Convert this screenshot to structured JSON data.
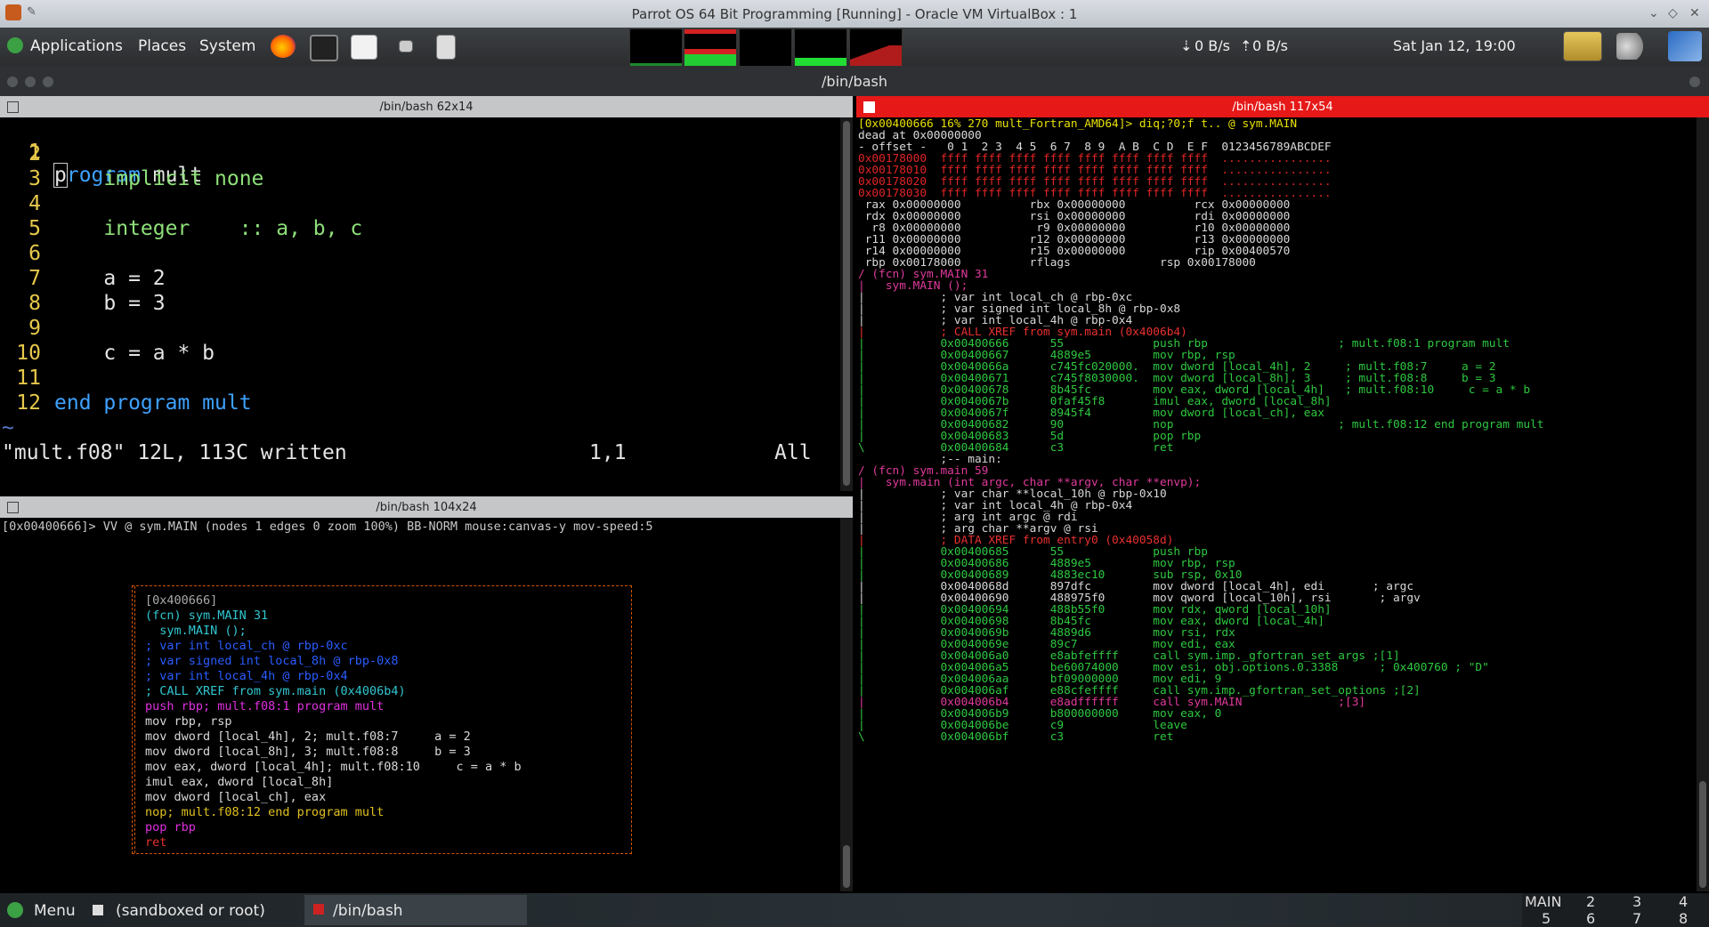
{
  "vbox": {
    "title": "Parrot OS 64 Bit Programming [Running] - Oracle VM VirtualBox : 1"
  },
  "panel": {
    "menu": [
      "Applications",
      "Places",
      "System"
    ],
    "net_down": "0 B/s",
    "net_up": "0 B/s",
    "clock": "Sat Jan 12, 19:00"
  },
  "terminator": {
    "title": "/bin/bash"
  },
  "panes": {
    "vim_title": "/bin/bash 62x14",
    "vv_title": "/bin/bash 104x24",
    "r2_title": "/bin/bash 117x54"
  },
  "vim": {
    "lines": [
      {
        "n": "1",
        "t": "program mult"
      },
      {
        "n": "2",
        "t": ""
      },
      {
        "n": "3",
        "t": "    implicit none"
      },
      {
        "n": "4",
        "t": ""
      },
      {
        "n": "5",
        "t": "    integer    :: a, b, c"
      },
      {
        "n": "6",
        "t": ""
      },
      {
        "n": "7",
        "t": "    a = 2"
      },
      {
        "n": "8",
        "t": "    b = 3"
      },
      {
        "n": "9",
        "t": ""
      },
      {
        "n": "10",
        "t": "    c = a * b"
      },
      {
        "n": "11",
        "t": ""
      },
      {
        "n": "12",
        "t": "end program mult"
      }
    ],
    "tilde": "~",
    "status_msg": "\"mult.f08\" 12L, 113C written",
    "status_pos": "1,1",
    "status_all": "All"
  },
  "vv": {
    "header": "[0x00400666]> VV @ sym.MAIN (nodes 1 edges 0 zoom 100%) BB-NORM mouse:canvas-y mov-speed:5",
    "box_lines": [
      "[0x400666]",
      "(fcn) sym.MAIN 31",
      "  sym.MAIN ();",
      "; var int local_ch @ rbp-0xc",
      "; var signed int local_8h @ rbp-0x8",
      "; var int local_4h @ rbp-0x4",
      "; CALL XREF from sym.main (0x4006b4)",
      "push rbp; mult.f08:1 program mult",
      "mov rbp, rsp",
      "mov dword [local_4h], 2; mult.f08:7     a = 2",
      "mov dword [local_8h], 3; mult.f08:8     b = 3",
      "mov eax, dword [local_4h]; mult.f08:10     c = a * b",
      "imul eax, dword [local_8h]",
      "mov dword [local_ch], eax",
      "nop; mult.f08:12 end program mult",
      "pop rbp",
      "ret"
    ]
  },
  "r2": {
    "lines": [
      "[0x00400666 16% 270 mult_Fortran_AMD64]> diq;?0;f t.. @ sym.MAIN",
      "dead at 0x00000000",
      "- offset -   0 1  2 3  4 5  6 7  8 9  A B  C D  E F  0123456789ABCDEF",
      "0x00178000  ffff ffff ffff ffff ffff ffff ffff ffff  ................",
      "0x00178010  ffff ffff ffff ffff ffff ffff ffff ffff  ................",
      "0x00178020  ffff ffff ffff ffff ffff ffff ffff ffff  ................",
      "0x00178030  ffff ffff ffff ffff ffff ffff ffff ffff  ................",
      " rax 0x00000000          rbx 0x00000000          rcx 0x00000000",
      " rdx 0x00000000          rsi 0x00000000          rdi 0x00000000",
      "  r8 0x00000000           r9 0x00000000          r10 0x00000000",
      " r11 0x00000000          r12 0x00000000          r13 0x00000000",
      " r14 0x00000000          r15 0x00000000          rip 0x00400570",
      " rbp 0x00178000          rflags             rsp 0x00178000",
      "/ (fcn) sym.MAIN 31",
      "|   sym.MAIN ();",
      "|           ; var int local_ch @ rbp-0xc",
      "|           ; var signed int local_8h @ rbp-0x8",
      "|           ; var int local_4h @ rbp-0x4",
      "|           ; CALL XREF from sym.main (0x4006b4)",
      "|           0x00400666      55             push rbp                   ; mult.f08:1 program mult",
      "|           0x00400667      4889e5         mov rbp, rsp",
      "|           0x0040066a      c745fc020000.  mov dword [local_4h], 2     ; mult.f08:7     a = 2",
      "|           0x00400671      c745f8030000.  mov dword [local_8h], 3     ; mult.f08:8     b = 3",
      "|           0x00400678      8b45fc         mov eax, dword [local_4h]   ; mult.f08:10     c = a * b",
      "|           0x0040067b      0faf45f8       imul eax, dword [local_8h]",
      "|           0x0040067f      8945f4         mov dword [local_ch], eax",
      "|           0x00400682      90             nop                        ; mult.f08:12 end program mult",
      "|           0x00400683      5d             pop rbp",
      "\\           0x00400684      c3             ret",
      "            ;-- main:",
      "/ (fcn) sym.main 59",
      "|   sym.main (int argc, char **argv, char **envp);",
      "|           ; var char **local_10h @ rbp-0x10",
      "|           ; var int local_4h @ rbp-0x4",
      "|           ; arg int argc @ rdi",
      "|           ; arg char **argv @ rsi",
      "|           ; DATA XREF from entry0 (0x40058d)",
      "|           0x00400685      55             push rbp",
      "|           0x00400686      4889e5         mov rbp, rsp",
      "|           0x00400689      4883ec10       sub rsp, 0x10",
      "|           0x0040068d      897dfc         mov dword [local_4h], edi       ; argc",
      "|           0x00400690      488975f0       mov qword [local_10h], rsi       ; argv",
      "|           0x00400694      488b55f0       mov rdx, qword [local_10h]",
      "|           0x00400698      8b45fc         mov eax, dword [local_4h]",
      "|           0x0040069b      4889d6         mov rsi, rdx",
      "|           0x0040069e      89c7           mov edi, eax",
      "|           0x004006a0      e8abfeffff     call sym.imp._gfortran_set_args ;[1]",
      "|           0x004006a5      be60074000     mov esi, obj.options.0.3388      ; 0x400760 ; \"D\"",
      "|           0x004006aa      bf09000000     mov edi, 9",
      "|           0x004006af      e88cfeffff     call sym.imp._gfortran_set_options ;[2]",
      "|           0x004006b4      e8adffffff     call sym.MAIN              ;[3]",
      "|           0x004006b9      b800000000     mov eax, 0",
      "|           0x004006be      c9             leave",
      "\\           0x004006bf      c3             ret"
    ]
  },
  "taskbar": {
    "menu": "Menu",
    "item1": "(sandboxed or root)",
    "item2": "/bin/bash",
    "ws_name": "MAIN",
    "ws": [
      "2",
      "3",
      "4",
      "5",
      "6",
      "7",
      "8"
    ]
  }
}
